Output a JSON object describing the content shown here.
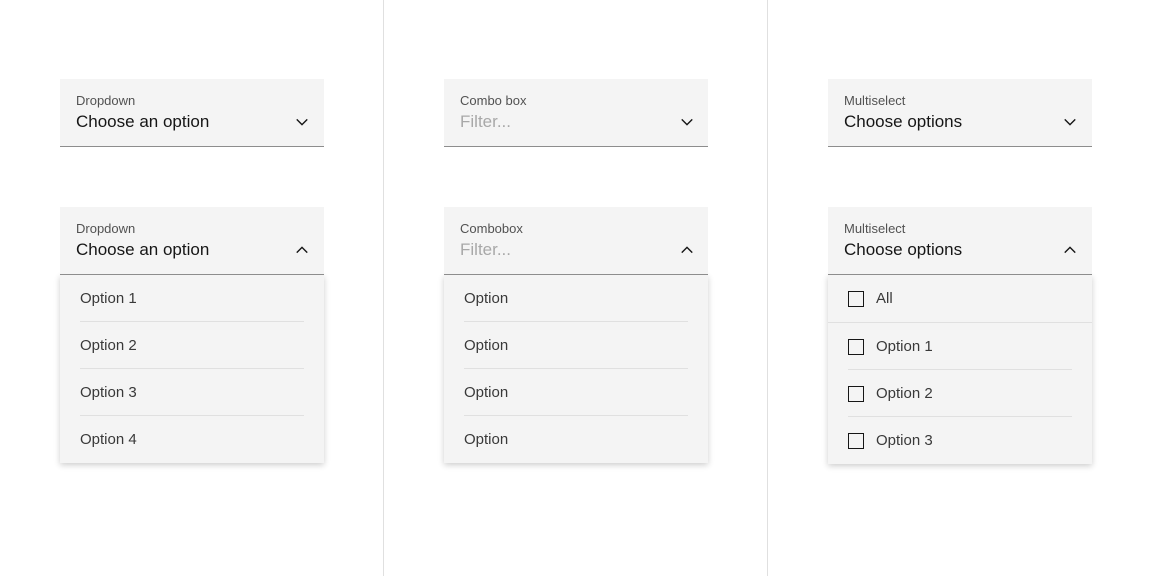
{
  "dropdown": {
    "closed": {
      "label": "Dropdown",
      "value": "Choose an option"
    },
    "open": {
      "label": "Dropdown",
      "value": "Choose an option"
    },
    "options": [
      "Option 1",
      "Option 2",
      "Option 3",
      "Option 4"
    ]
  },
  "combobox": {
    "closed": {
      "label": "Combo box",
      "placeholder": "Filter..."
    },
    "open": {
      "label": "Combobox",
      "placeholder": "Filter..."
    },
    "options": [
      "Option",
      "Option",
      "Option",
      "Option"
    ]
  },
  "multiselect": {
    "closed": {
      "label": "Multiselect",
      "value": "Choose options"
    },
    "open": {
      "label": "Multiselect",
      "value": "Choose options"
    },
    "options": [
      "All",
      "Option 1",
      "Option 2",
      "Option 3"
    ]
  }
}
